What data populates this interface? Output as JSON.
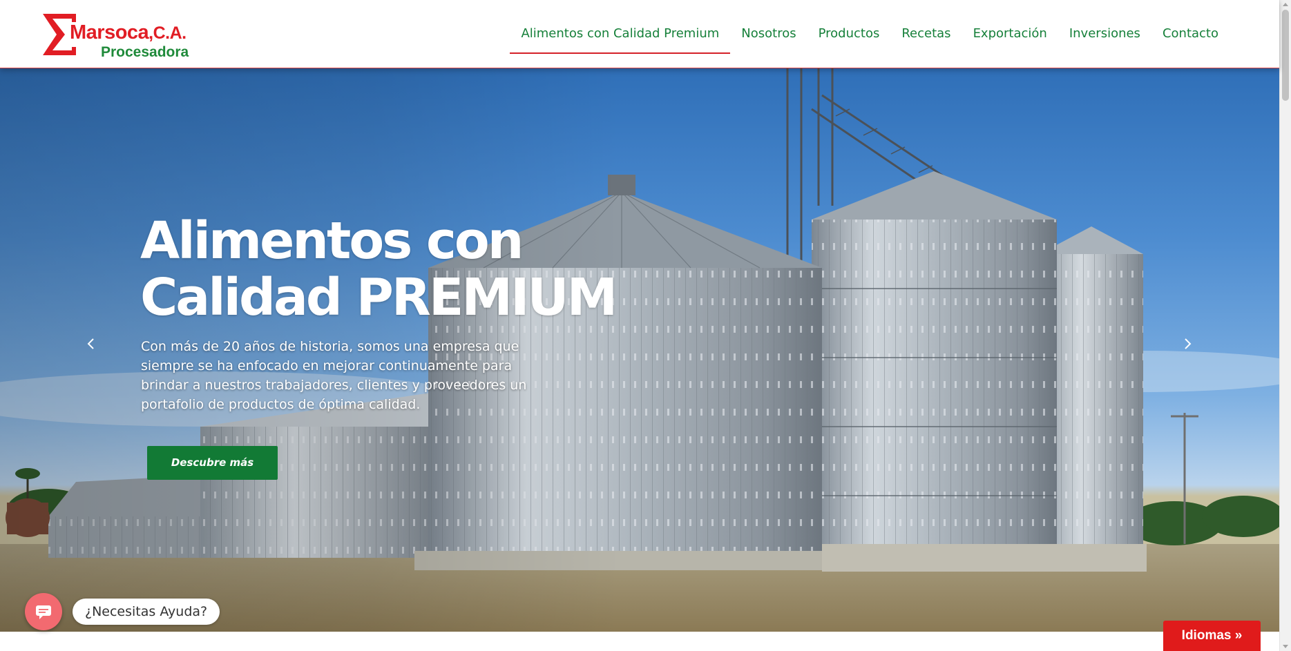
{
  "brand": {
    "name": "Marsoca",
    "suffix": ",C.A.",
    "subtitle": "Procesadora",
    "primary_color": "#e11d24",
    "secondary_color": "#1f8a3a"
  },
  "nav": {
    "items": [
      {
        "label": "Alimentos con Calidad Premium",
        "active": true
      },
      {
        "label": "Nosotros",
        "active": false
      },
      {
        "label": "Productos",
        "active": false
      },
      {
        "label": "Recetas",
        "active": false
      },
      {
        "label": "Exportación",
        "active": false
      },
      {
        "label": "Inversiones",
        "active": false
      },
      {
        "label": "Contacto",
        "active": false
      }
    ],
    "active_underline_color": "#d42027",
    "text_color": "#16803a"
  },
  "hero": {
    "title_line1": "Alimentos con",
    "title_line2": "Calidad PREMIUM",
    "description": "Con más de 20 años de historia, somos una empresa que siempre se ha enfocado en mejorar continuamente para brindar a nuestros trabajadores, clientes y proveedores un portafolio de productos de óptima calidad.",
    "cta_label": "Descubre más",
    "cta_color": "#127a35",
    "prev_icon": "chevron-left-icon",
    "next_icon": "chevron-right-icon"
  },
  "chat": {
    "prompt": "¿Necesitas Ayuda?",
    "icon": "chat-icon",
    "color": "#f26a70"
  },
  "language": {
    "label": "Idiomas »",
    "color": "#e01b1b"
  }
}
